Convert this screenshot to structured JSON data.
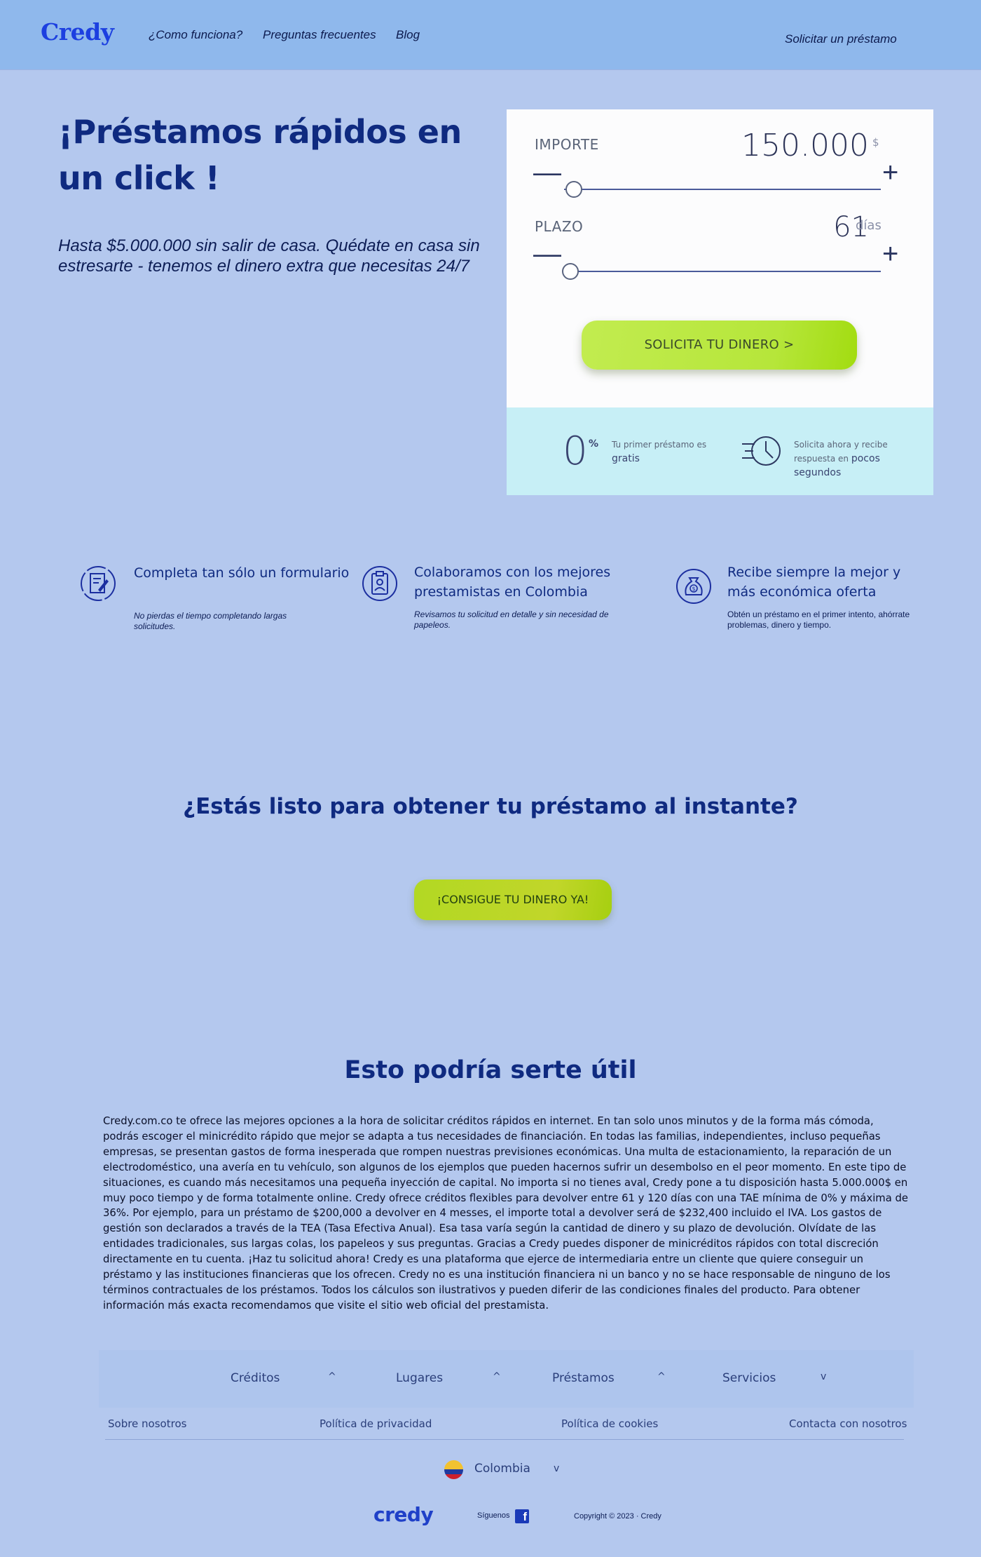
{
  "header": {
    "logo": "Credy",
    "nav": [
      "¿Como funciona?",
      "Preguntas frecuentes",
      "Blog"
    ],
    "cta": "Solicitar un préstamo"
  },
  "hero": {
    "title": "¡Préstamos rápidos en un click !",
    "subtitle": "Hasta $5.000.000 sin salir de casa. Quédate en casa sin estresarte - tenemos el dinero extra que necesitas 24/7"
  },
  "calculator": {
    "amount_label": "IMPORTE",
    "amount_value": "150.000",
    "amount_unit": "$",
    "amount_slider_level": 0.03,
    "term_label": "PLAZO",
    "term_value": "61",
    "term_unit": "días",
    "term_slider_level": 0.02,
    "minus": "—",
    "plus": "+",
    "submit": "SOLICITA TU DINERO   >",
    "promo_value": "0",
    "promo_pct": "%",
    "promo_text": "Tu primer préstamo es",
    "promo_bold": "gratis",
    "speed_text": "Solicita ahora y recibe respuesta en",
    "speed_bold": "pocos segundos",
    "speed_icon": "clock-fast-icon"
  },
  "features": [
    {
      "icon": "form-icon",
      "title": "Completa tan sólo un formulario",
      "desc": "No pierdas el tiempo completando largas solicitudes."
    },
    {
      "icon": "clipboard-icon",
      "title": "Colaboramos con los mejores prestamistas en Colombia",
      "desc": "Revisamos tu solicitud en detalle y sin necesidad de papeleos."
    },
    {
      "icon": "money-bag-icon",
      "title": "Recibe siempre la mejor y más económica oferta",
      "desc": "Obtén un préstamo en el primer intento, ahórrate problemas, dinero y tiempo."
    }
  ],
  "cta_section": {
    "heading": "¿Estás listo para obtener tu préstamo al instante?",
    "button": "¡CONSIGUE TU DINERO YA!"
  },
  "useful": {
    "title": "Esto podría serte útil",
    "text": "Credy.com.co te ofrece las mejores opciones a la hora de solicitar créditos rápidos en internet. En tan solo unos minutos y de la forma más cómoda, podrás escoger el minicrédito rápido que mejor se adapta a tus necesidades de financiación. En todas las familias, independientes, incluso pequeñas empresas, se presentan gastos de forma inesperada que rompen nuestras previsiones económicas. Una multa de estacionamiento, la reparación de un electrodoméstico, una avería en tu vehículo, son algunos de los ejemplos que pueden hacernos sufrir un desembolso en el peor momento. En este tipo de situaciones, es cuando más necesitamos una pequeña inyección de capital. No importa si no tienes aval, Credy pone a tu disposición hasta 5.000.000$ en muy poco tiempo y de forma totalmente online. Credy ofrece créditos flexibles para devolver entre 61 y 120 días con una TAE mínima de 0% y máxima de 36%. Por ejemplo, para un préstamo de $200,000 a devolver en 4 messes, el importe total a devolver será de $232,400 incluido el IVA. Los gastos de gestión son declarados a través de la TEA (Tasa Efectiva Anual). Esa tasa varía según la cantidad de dinero y su plazo de devolución. Olvídate de las entidades tradicionales, sus largas colas, los papeleos y sus preguntas. Gracias a Credy puedes disponer de minicréditos rápidos con total discreción directamente en tu cuenta. ¡Haz tu solicitud ahora! Credy es una plataforma que ejerce de intermediaria entre un cliente que quiere conseguir un préstamo y las instituciones financieras que los ofrecen. Credy no es una institución financiera ni un banco y no se hace responsable de ninguno de los términos contractuales de los préstamos. Todos los cálculos son ilustrativos y pueden diferir de las condiciones finales del producto. Para obtener información más exacta recomendamos que visite el sitio web oficial del prestamista."
  },
  "footer": {
    "nav": [
      {
        "label": "Créditos",
        "chevron": "^"
      },
      {
        "label": "Lugares",
        "chevron": "^"
      },
      {
        "label": "Préstamos",
        "chevron": "^"
      },
      {
        "label": "Servicios",
        "chevron": "v"
      }
    ],
    "links": [
      "Sobre nosotros",
      "Política de privacidad",
      "Política de cookies",
      "Contacta con nosotros"
    ],
    "country": "Colombia",
    "country_chevron": "v",
    "flag_colors": [
      "#f2c230",
      "#1f3a9e",
      "#cc1f2c"
    ],
    "logo": "credy",
    "follow": "Síguenos",
    "facebook_icon": "facebook-icon",
    "facebook_glyph": "f",
    "copyright": "Copyright © 2023 · Credy"
  },
  "colors": {
    "background": "#b4c8ee",
    "header": "#8fb8ec",
    "brand": "#1c3fe0",
    "heading": "#0f2a80",
    "accent_green": "#b6e63a",
    "card_footer": "#c7eff6"
  }
}
